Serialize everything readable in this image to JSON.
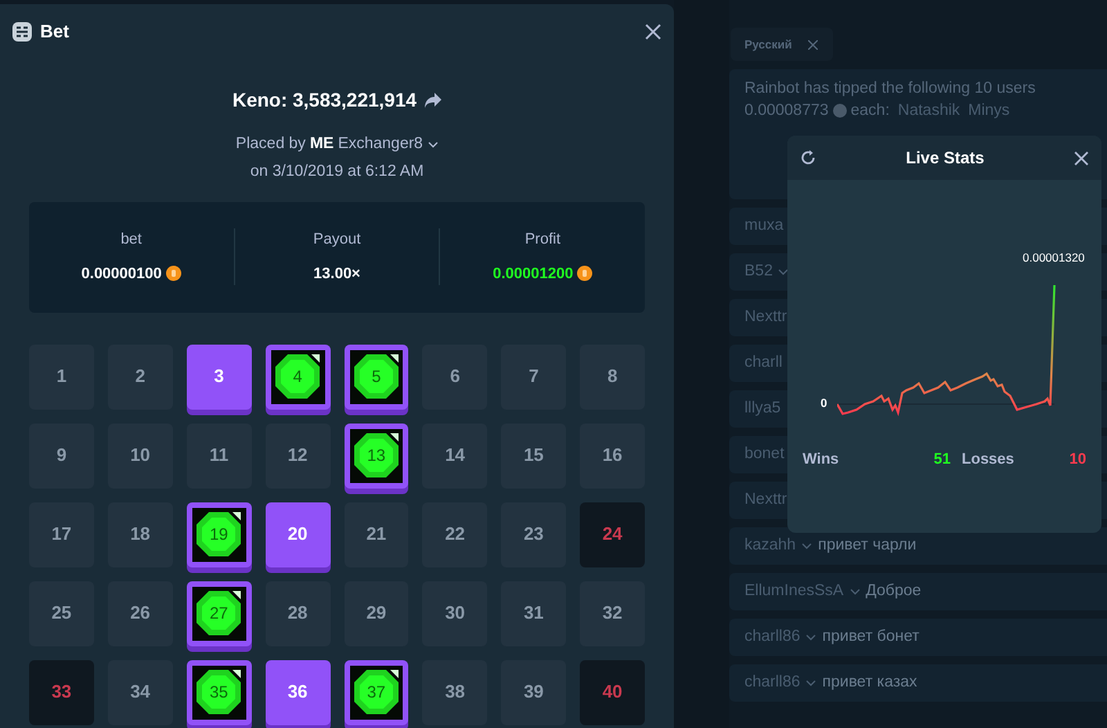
{
  "bet_modal": {
    "title": "Bet",
    "game_title": "Keno: 3,583,221,914",
    "placed_by_label": "Placed by",
    "user_badge": "ME",
    "username": "Exchanger8",
    "date_line": "on 3/10/2019 at 6:12 AM",
    "stats": [
      {
        "label": "bet",
        "value": "0.00000100",
        "coin": true,
        "positive": false
      },
      {
        "label": "Payout",
        "value": "13.00×",
        "coin": false,
        "positive": false
      },
      {
        "label": "Profit",
        "value": "0.00001200",
        "coin": true,
        "positive": true
      }
    ],
    "tiles": [
      {
        "number": "1",
        "kind": "plain"
      },
      {
        "number": "2",
        "kind": "plain"
      },
      {
        "number": "3",
        "kind": "picked"
      },
      {
        "number": "4",
        "kind": "hit"
      },
      {
        "number": "5",
        "kind": "hit"
      },
      {
        "number": "6",
        "kind": "plain"
      },
      {
        "number": "7",
        "kind": "plain"
      },
      {
        "number": "8",
        "kind": "plain"
      },
      {
        "number": "9",
        "kind": "plain"
      },
      {
        "number": "10",
        "kind": "plain"
      },
      {
        "number": "11",
        "kind": "plain"
      },
      {
        "number": "12",
        "kind": "plain"
      },
      {
        "number": "13",
        "kind": "hit"
      },
      {
        "number": "14",
        "kind": "plain"
      },
      {
        "number": "15",
        "kind": "plain"
      },
      {
        "number": "16",
        "kind": "plain"
      },
      {
        "number": "17",
        "kind": "plain"
      },
      {
        "number": "18",
        "kind": "plain"
      },
      {
        "number": "19",
        "kind": "hit"
      },
      {
        "number": "20",
        "kind": "picked"
      },
      {
        "number": "21",
        "kind": "plain"
      },
      {
        "number": "22",
        "kind": "plain"
      },
      {
        "number": "23",
        "kind": "plain"
      },
      {
        "number": "24",
        "kind": "drawn"
      },
      {
        "number": "25",
        "kind": "plain"
      },
      {
        "number": "26",
        "kind": "plain"
      },
      {
        "number": "27",
        "kind": "hit"
      },
      {
        "number": "28",
        "kind": "plain"
      },
      {
        "number": "29",
        "kind": "plain"
      },
      {
        "number": "30",
        "kind": "plain"
      },
      {
        "number": "31",
        "kind": "plain"
      },
      {
        "number": "32",
        "kind": "plain"
      },
      {
        "number": "33",
        "kind": "drawn"
      },
      {
        "number": "34",
        "kind": "plain"
      },
      {
        "number": "35",
        "kind": "hit"
      },
      {
        "number": "36",
        "kind": "picked"
      },
      {
        "number": "37",
        "kind": "hit"
      },
      {
        "number": "38",
        "kind": "plain"
      },
      {
        "number": "39",
        "kind": "plain"
      },
      {
        "number": "40",
        "kind": "drawn"
      }
    ]
  },
  "chat": {
    "language_tab": "Русский",
    "tip_message": {
      "text": "Rainbot has tipped the following 10 users",
      "amount": "0.00008773",
      "each": "each:",
      "users": [
        "Natashik",
        "Minys"
      ]
    },
    "messages": [
      {
        "user": "muxa"
      },
      {
        "user": "B52",
        "menu": true
      },
      {
        "user": "Nexttr"
      },
      {
        "user": "charll"
      },
      {
        "user": "lllya5"
      },
      {
        "user": "bonet"
      },
      {
        "user": "Nexttr"
      },
      {
        "user": "kazahh",
        "text": "привет чарли",
        "menu": true
      },
      {
        "user": "EllumInesSsA",
        "text": "Доброе",
        "menu": true
      },
      {
        "user": "charll86",
        "text": "привет бонет",
        "menu": true
      },
      {
        "user": "charll86",
        "text": "привет казах",
        "menu": true
      }
    ]
  },
  "live_stats": {
    "title": "Live Stats",
    "zero_label": "0",
    "max_label": "0.00001320",
    "wins_label": "Wins",
    "wins": "51",
    "losses_label": "Losses",
    "losses": "10"
  }
}
